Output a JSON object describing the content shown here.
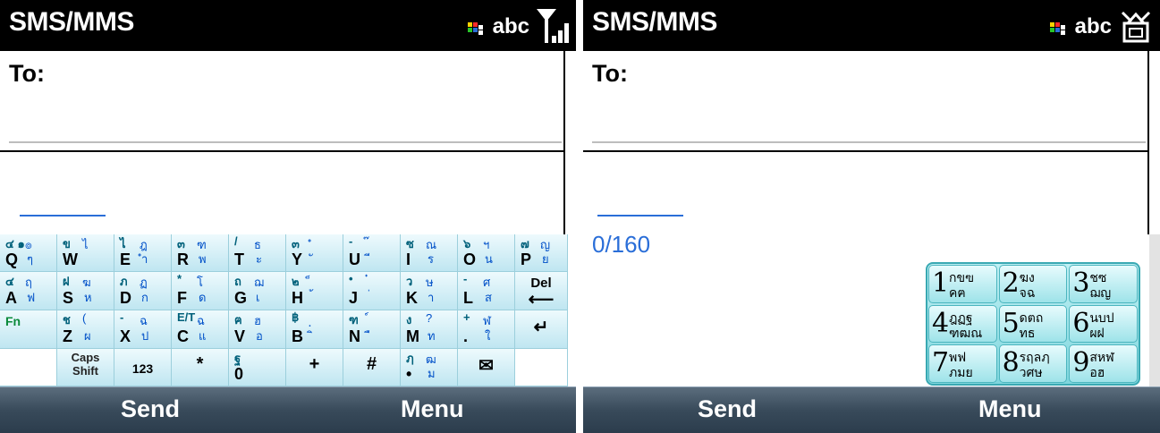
{
  "screens": [
    {
      "title": "SMS/MMS",
      "status": {
        "input_mode": "abc",
        "icons": [
          "input-mode-icon",
          "signal-strength-icon"
        ]
      },
      "to_label": "To:",
      "keyboard": {
        "rows": [
          [
            {
              "lat": "Q",
              "sym": "๔ ๑",
              "th": [
                "๏",
                "ๆ"
              ]
            },
            {
              "lat": "W",
              "sym": "ข",
              "th": [
                "ไ",
                ""
              ]
            },
            {
              "lat": "E",
              "sym": "ไ",
              "th": [
                "ฎ",
                "ำ"
              ]
            },
            {
              "lat": "R",
              "sym": "๓",
              "th": [
                "ฑ",
                "พ"
              ]
            },
            {
              "lat": "T",
              "sym": "/",
              "th": [
                "ธ",
                "ะ"
              ]
            },
            {
              "lat": "Y",
              "sym": "๓",
              "th": [
                "ํ",
                "ั"
              ]
            },
            {
              "lat": "U",
              "sym": "-",
              "th": [
                "๊",
                "ี"
              ]
            },
            {
              "lat": "I",
              "sym": "ซ",
              "th": [
                "ณ",
                "ร"
              ]
            },
            {
              "lat": "O",
              "sym": "๖",
              "th": [
                "ฯ",
                "น"
              ]
            },
            {
              "lat": "P",
              "sym": "๗",
              "th": [
                "ญ",
                "ย"
              ]
            }
          ],
          [
            {
              "lat": "A",
              "sym": "๔",
              "th": [
                "ฤ",
                "ฟ"
              ]
            },
            {
              "lat": "S",
              "sym": "ฝ",
              "th": [
                "ฆ",
                "ห"
              ]
            },
            {
              "lat": "D",
              "sym": "ภ",
              "th": [
                "ฏ",
                "ก"
              ]
            },
            {
              "lat": "F",
              "sym": "*",
              "th": [
                "โ",
                "ด"
              ]
            },
            {
              "lat": "G",
              "sym": "ถ",
              "th": [
                "ฌ",
                "เ"
              ]
            },
            {
              "lat": "H",
              "sym": "๒",
              "th": [
                "็",
                "้"
              ]
            },
            {
              "lat": "J",
              "sym": "•",
              "th": [
                "๋",
                "่"
              ]
            },
            {
              "lat": "K",
              "sym": "ว",
              "th": [
                "ษ",
                "า"
              ]
            },
            {
              "lat": "L",
              "sym": "-",
              "th": [
                "ศ",
                "ส"
              ]
            },
            {
              "lat": "Del",
              "special": "del"
            }
          ],
          [
            {
              "lat": "Fn",
              "special": "fn"
            },
            {
              "lat": "Z",
              "sym": "ช",
              "th": [
                "(",
                "ผ"
              ]
            },
            {
              "lat": "X",
              "sym": "-",
              "th": [
                "ฉ",
                "ป"
              ]
            },
            {
              "lat": "C",
              "sym": "E/T",
              "th": [
                "ฉ",
                "แ"
              ]
            },
            {
              "lat": "V",
              "sym": "ฅ",
              "th": [
                "ฮ",
                "อ"
              ]
            },
            {
              "lat": "B",
              "sym": "฿",
              "th": [
                "ฺ",
                "ิ"
              ]
            },
            {
              "lat": "N",
              "sym": "ฑ",
              "th": [
                "์",
                "ื"
              ]
            },
            {
              "lat": "M",
              "sym": "ง",
              "th": [
                "?",
                "ท"
              ]
            },
            {
              "lat": ".",
              "sym": "+",
              "th": [
                "ฬ",
                "ใ"
              ]
            },
            {
              "lat": "↵",
              "special": "enter"
            }
          ],
          [
            {
              "lat": "",
              "special": "blank"
            },
            {
              "lat": "Caps Shift",
              "special": "caps"
            },
            {
              "lat": "123",
              "special": "num"
            },
            {
              "lat": "*",
              "special": "star"
            },
            {
              "lat": "0",
              "sym": "ฐ",
              "th": [
                "",
                ""
              ]
            },
            {
              "lat": "+",
              "special": "plus"
            },
            {
              "lat": "#",
              "special": "hash"
            },
            {
              "lat": "•",
              "sym": "ฦ",
              "th": [
                "ฒ",
                "ม"
              ]
            },
            {
              "lat": "✉",
              "special": "mail"
            },
            {
              "lat": "",
              "special": "blank"
            }
          ]
        ]
      },
      "softkeys": {
        "left": "Send",
        "right": "Menu"
      }
    },
    {
      "title": "SMS/MMS",
      "status": {
        "input_mode": "abc",
        "icons": [
          "input-mode-icon",
          "messaging-icon"
        ]
      },
      "to_label": "To:",
      "counter": "0/160",
      "numpad": [
        {
          "digit": "1",
          "th1": "กขฃ",
          "th2": "คฅ"
        },
        {
          "digit": "2",
          "th1": "ฆง",
          "th2": "จฉ"
        },
        {
          "digit": "3",
          "th1": "ชซ",
          "th2": "ฌญ"
        },
        {
          "digit": "4",
          "th1": "ฎฏฐ",
          "th2": "ฑฒณ"
        },
        {
          "digit": "5",
          "th1": "ดตถ",
          "th2": "ทธ"
        },
        {
          "digit": "6",
          "th1": "นบป",
          "th2": "ผฝ"
        },
        {
          "digit": "7",
          "th1": "พฟ",
          "th2": "ภมย"
        },
        {
          "digit": "8",
          "th1": "รฤลฦ",
          "th2": "วศษ"
        },
        {
          "digit": "9",
          "th1": "สหฬ",
          "th2": "อฮ"
        }
      ],
      "softkeys": {
        "left": "Send",
        "right": "Menu"
      }
    }
  ],
  "colors": {
    "accent_blue": "#2a6ed8",
    "title_bar": "#000000",
    "softkey_bar": "#384a5a",
    "keypad_cyan": "#9ee3e9"
  }
}
